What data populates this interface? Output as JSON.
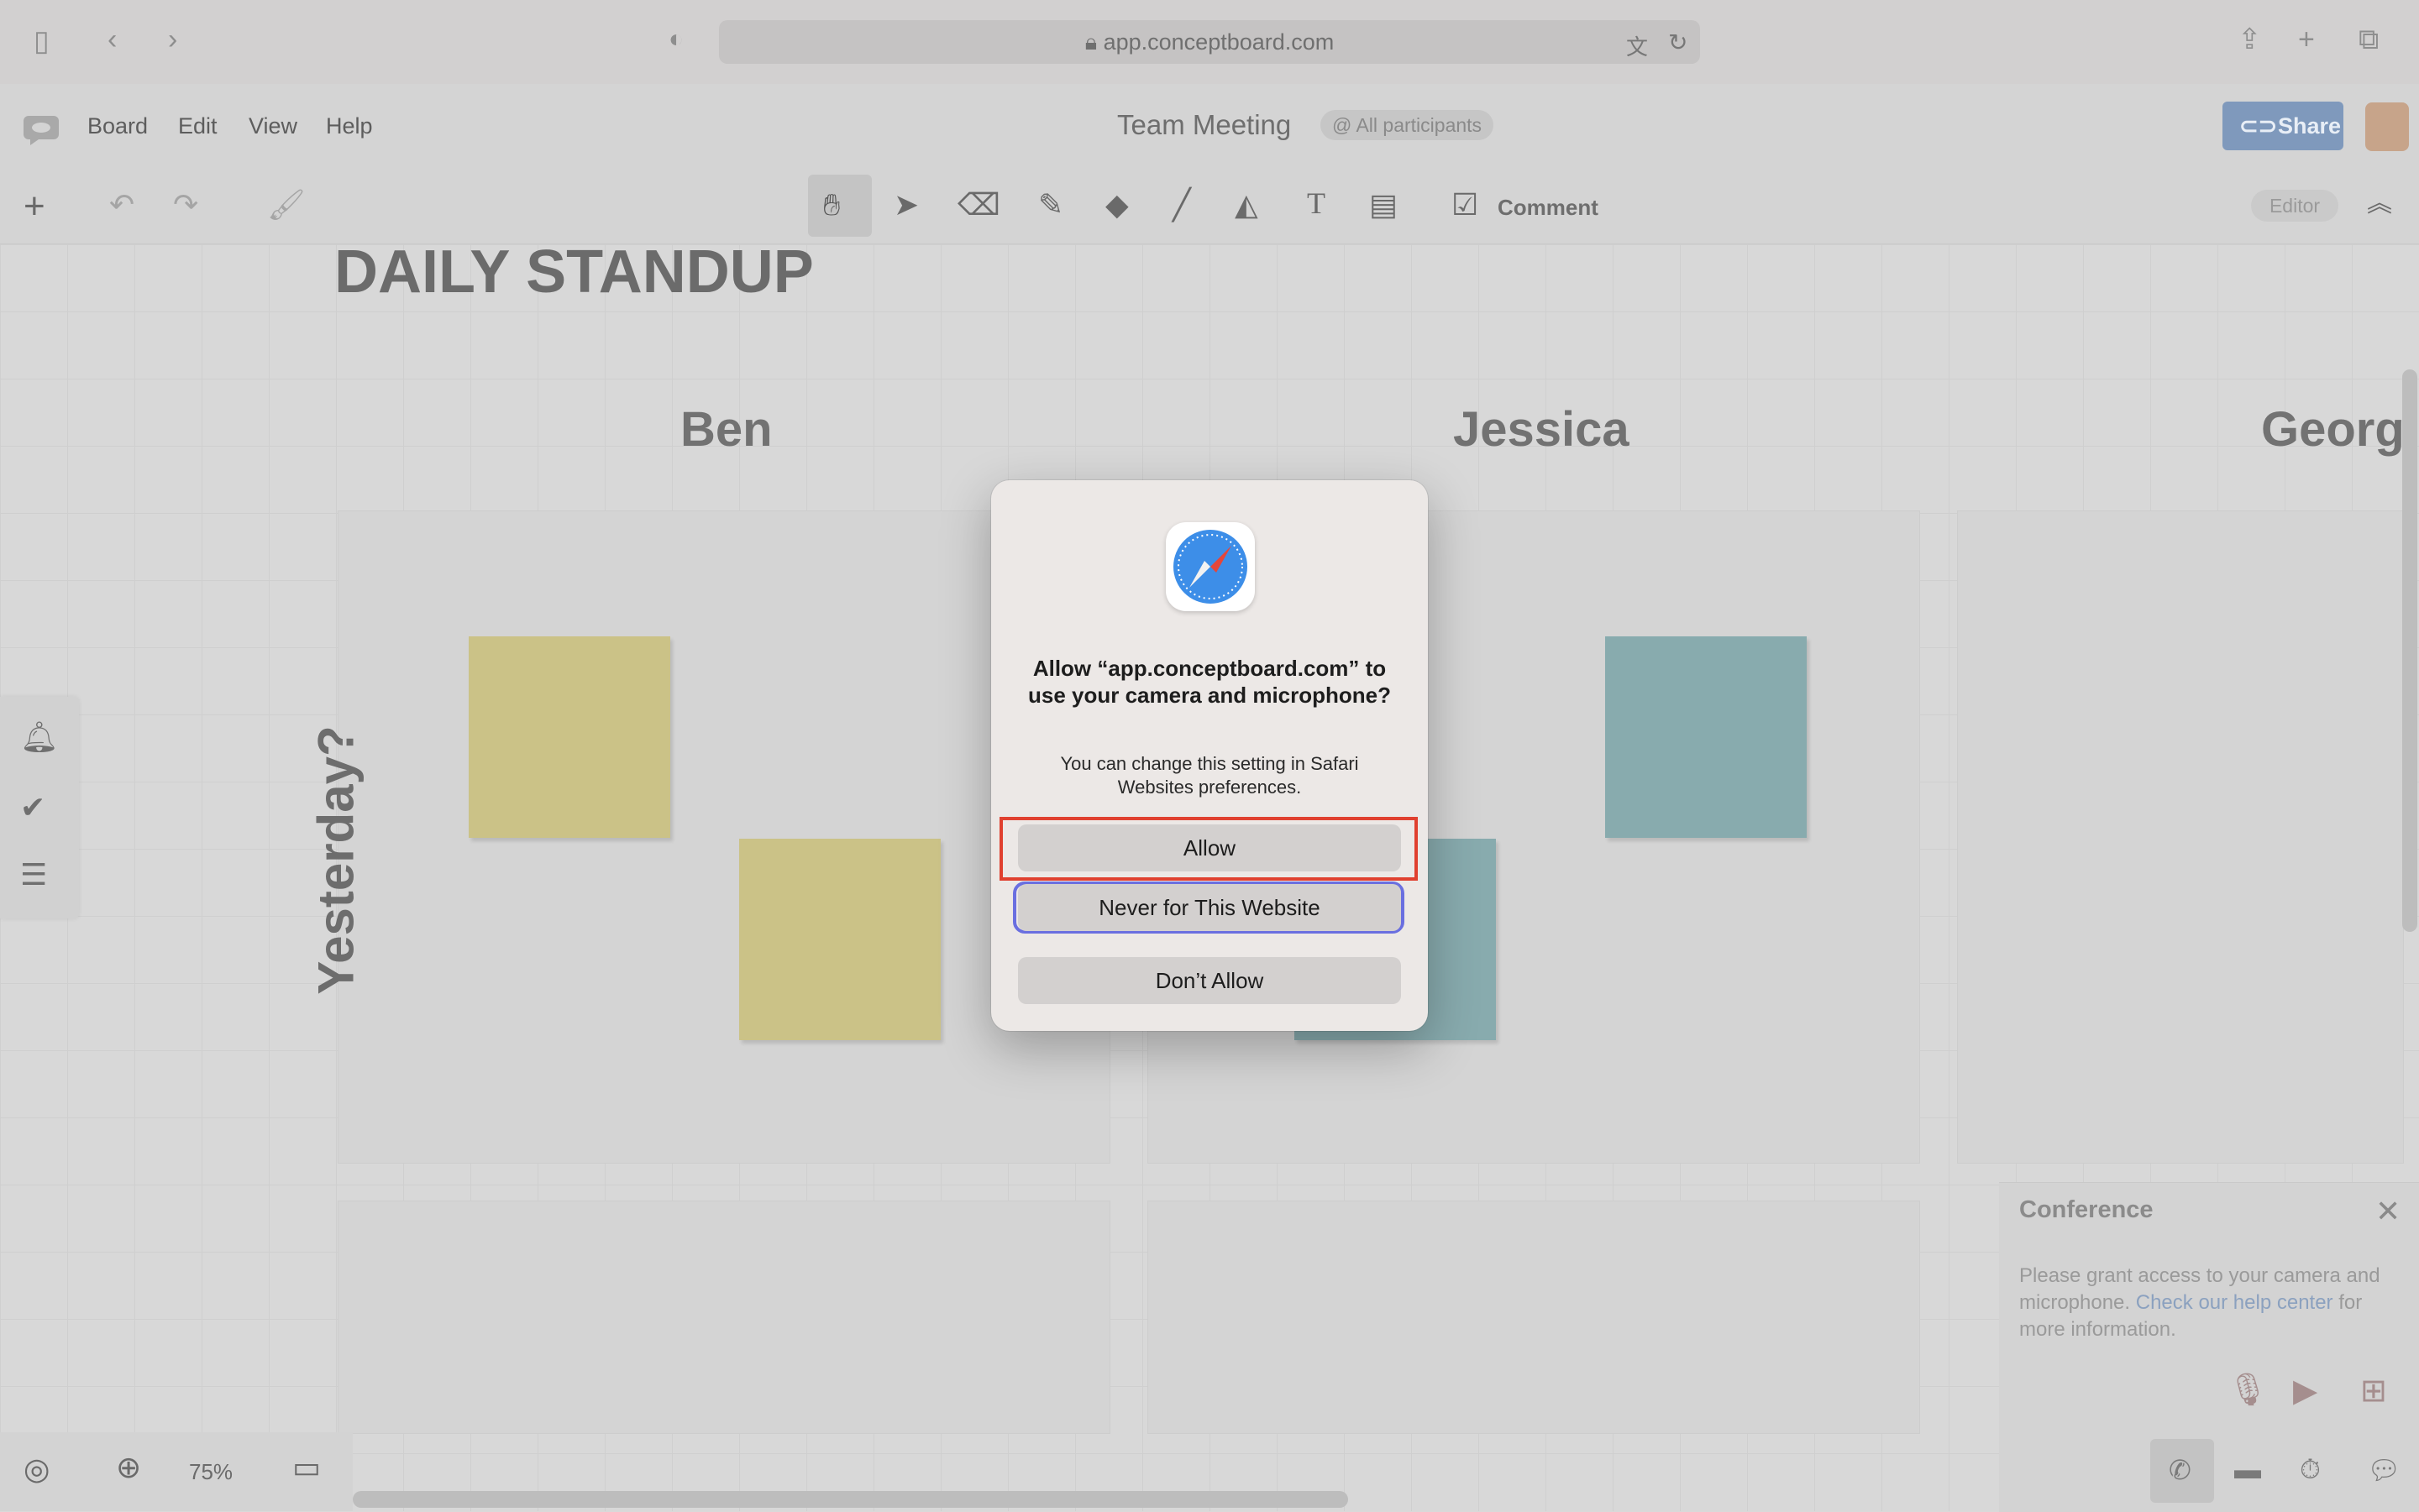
{
  "browser": {
    "url": "app.conceptboard.com"
  },
  "app": {
    "menu": [
      "Board",
      "Edit",
      "View",
      "Help"
    ],
    "board_title": "Team Meeting",
    "participants_badge": "@ All participants",
    "share_label": "Share",
    "comment_label": "Comment",
    "editor_badge": "Editor"
  },
  "board": {
    "heading": "DAILY STANDUP",
    "columns": [
      "Ben",
      "Jessica",
      "George"
    ],
    "row_label": "Yesterday?"
  },
  "zoom": {
    "level": "75%"
  },
  "conference": {
    "title": "Conference",
    "message_pre": "Please grant access to your camera and microphone. ",
    "message_link": "Check our help center",
    "message_post": " for more information."
  },
  "dialog": {
    "title": "Allow “app.conceptboard.com” to use your camera and microphone?",
    "message": "You can change this setting in Safari Websites preferences.",
    "allow_label": "Allow",
    "never_label": "Never for This Website",
    "dont_allow_label": "Don’t Allow"
  },
  "colors": {
    "sticky_yellow": "#cbc287",
    "sticky_teal": "#88abae",
    "highlight_border": "#e0402f",
    "focus_ring": "#6a6fe0"
  }
}
